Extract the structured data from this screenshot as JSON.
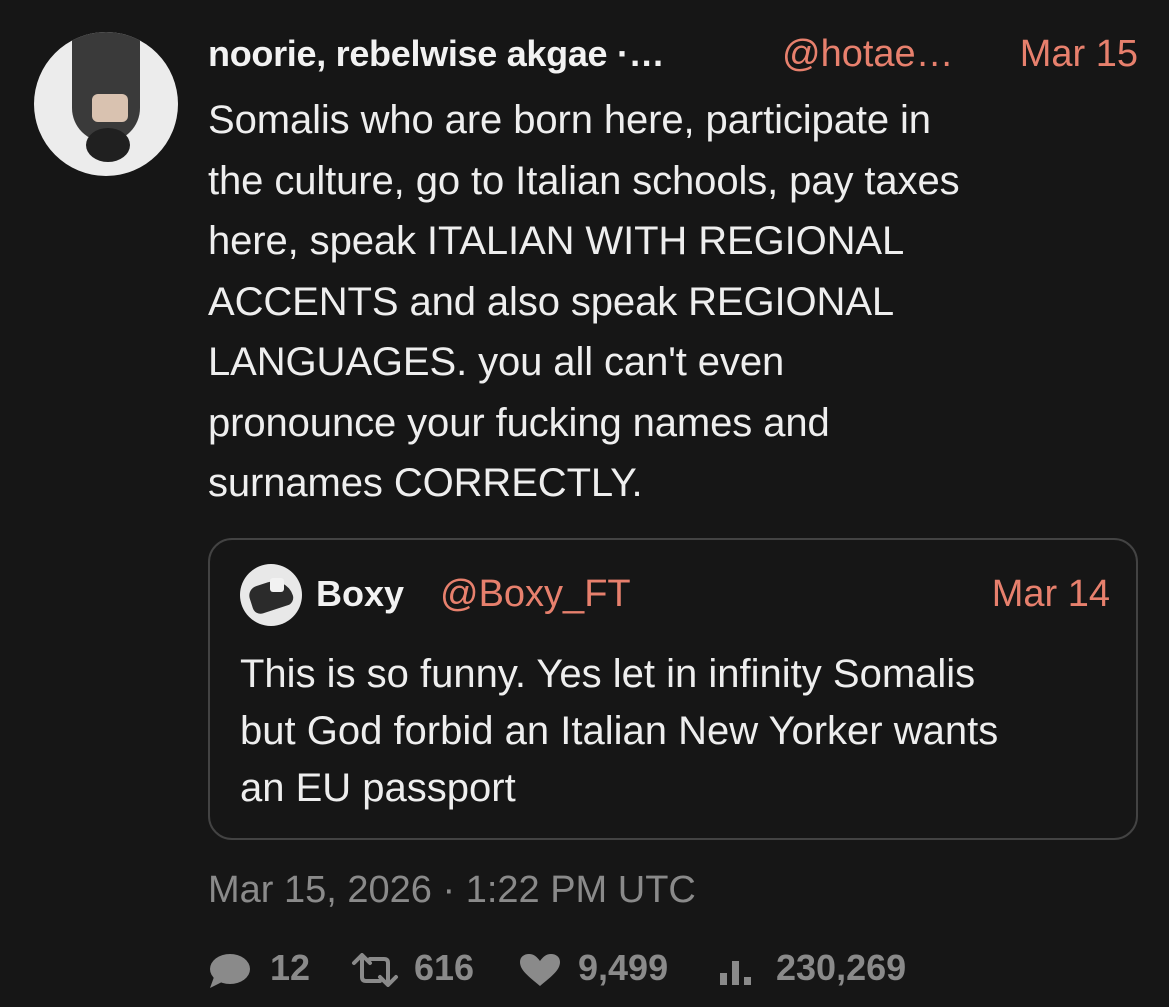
{
  "tweet": {
    "author_name": "noorie, rebelwise akgae ·…",
    "handle": "@hotae…",
    "date": "Mar 15",
    "text": "Somalis who are born here, participate in\nthe culture, go to Italian schools, pay taxes\nhere, speak ITALIAN WITH REGIONAL\nACCENTS and also speak REGIONAL\nLANGUAGES. you all can't even\npronounce your fucking names and\nsurnames CORRECTLY.",
    "timestamp": "Mar 15, 2026 · 1:22 PM UTC"
  },
  "quoted_tweet": {
    "author_name": "Boxy",
    "handle": "@Boxy_FT",
    "date": "Mar 14",
    "text": "This is so funny. Yes let in infinity Somalis\nbut God forbid an Italian New Yorker wants\nan EU passport"
  },
  "stats": {
    "replies": "12",
    "retweets": "616",
    "likes": "9,499",
    "views": "230,269"
  },
  "colors": {
    "background": "#161616",
    "accent": "#e7806d",
    "muted": "#8a8a8a",
    "text": "#eeeeee",
    "border": "#434343"
  },
  "icons": {
    "replies": "comment-icon",
    "retweets": "retweet-icon",
    "likes": "heart-icon",
    "views": "views-icon"
  }
}
